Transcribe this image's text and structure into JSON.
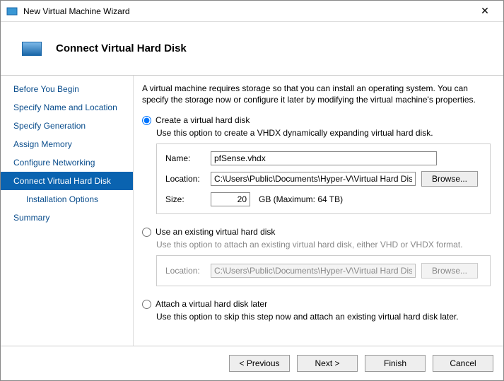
{
  "window": {
    "title": "New Virtual Machine Wizard"
  },
  "header": {
    "title": "Connect Virtual Hard Disk"
  },
  "sidebar": {
    "steps": [
      "Before You Begin",
      "Specify Name and Location",
      "Specify Generation",
      "Assign Memory",
      "Configure Networking",
      "Connect Virtual Hard Disk",
      "Installation Options",
      "Summary"
    ]
  },
  "intro": "A virtual machine requires storage so that you can install an operating system. You can specify the storage now or configure it later by modifying the virtual machine's properties.",
  "opt1": {
    "label": "Create a virtual hard disk",
    "desc": "Use this option to create a VHDX dynamically expanding virtual hard disk.",
    "name_label": "Name:",
    "name_value": "pfSense.vhdx",
    "loc_label": "Location:",
    "loc_value": "C:\\Users\\Public\\Documents\\Hyper-V\\Virtual Hard Disks\\",
    "browse": "Browse...",
    "size_label": "Size:",
    "size_value": "20",
    "size_suffix": "GB (Maximum: 64 TB)"
  },
  "opt2": {
    "label": "Use an existing virtual hard disk",
    "desc": "Use this option to attach an existing virtual hard disk, either VHD or VHDX format.",
    "loc_label": "Location:",
    "loc_value": "C:\\Users\\Public\\Documents\\Hyper-V\\Virtual Hard Disks\\",
    "browse": "Browse..."
  },
  "opt3": {
    "label": "Attach a virtual hard disk later",
    "desc": "Use this option to skip this step now and attach an existing virtual hard disk later."
  },
  "footer": {
    "prev": "< Previous",
    "next": "Next >",
    "finish": "Finish",
    "cancel": "Cancel"
  }
}
